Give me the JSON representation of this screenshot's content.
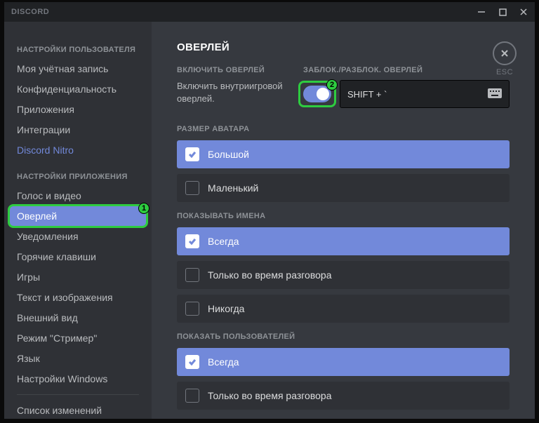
{
  "titlebar": {
    "app_name": "DISCORD"
  },
  "esc": {
    "label": "ESC"
  },
  "sidebar": {
    "section1_header": "НАСТРОЙКИ ПОЛЬЗОВАТЕЛЯ",
    "items1": [
      "Моя учётная запись",
      "Конфиденциальность",
      "Приложения",
      "Интеграции"
    ],
    "nitro": "Discord Nitro",
    "section2_header": "НАСТРОЙКИ ПРИЛОЖЕНИЯ",
    "items2": [
      "Голос и видео",
      "Оверлей",
      "Уведомления",
      "Горячие клавиши",
      "Игры",
      "Текст и изображения",
      "Внешний вид",
      "Режим \"Стример\"",
      "Язык",
      "Настройки Windows"
    ],
    "changelog": "Список изменений",
    "active_index": 1
  },
  "page": {
    "title": "ОВЕРЛЕЙ",
    "enable_label": "ВКЛЮЧИТЬ ОВЕРЛЕЙ",
    "enable_desc": "Включить внутриигровой оверлей.",
    "lock_label": "ЗАБЛОК./РАЗБЛОК. ОВЕРЛЕЙ",
    "keybind_value": "SHIFT + `",
    "toggle_on": true,
    "sections": [
      {
        "label": "РАЗМЕР АВАТАРА",
        "options": [
          "Большой",
          "Маленький"
        ],
        "selected": 0
      },
      {
        "label": "ПОКАЗЫВАТЬ ИМЕНА",
        "options": [
          "Всегда",
          "Только во время разговора",
          "Никогда"
        ],
        "selected": 0
      },
      {
        "label": "ПОКАЗАТЬ ПОЛЬЗОВАТЕЛЕЙ",
        "options": [
          "Всегда",
          "Только во время разговора"
        ],
        "selected": 0
      }
    ]
  },
  "callouts": {
    "one": "1",
    "two": "2"
  }
}
